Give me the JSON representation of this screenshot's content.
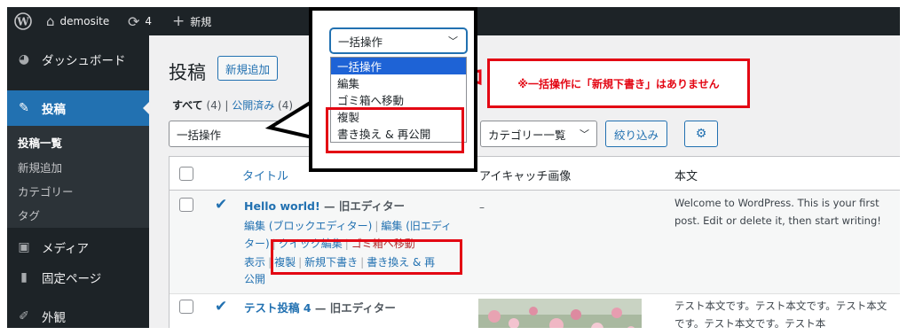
{
  "admin_bar": {
    "wp_logo_icon": "wordpress-icon",
    "site_name": "demosite",
    "updates_count": "4",
    "new_label": "新規"
  },
  "sidebar": {
    "items": [
      {
        "label": "ダッシュボード",
        "icon": "dashboard-icon"
      },
      {
        "label": "投稿",
        "icon": "pin-icon"
      },
      {
        "label": "メディア",
        "icon": "media-icon"
      },
      {
        "label": "固定ページ",
        "icon": "page-icon"
      },
      {
        "label": "外観",
        "icon": "brush-icon"
      }
    ],
    "submenu": [
      "投稿一覧",
      "新規追加",
      "カテゴリー",
      "タグ"
    ]
  },
  "main": {
    "title": "投稿",
    "add_new_label": "新規追加",
    "filter_all": "すべて",
    "filter_all_count": "(4)",
    "filter_published": "公開済み",
    "filter_published_count": "(4)",
    "bulk_action_value": "一括操作",
    "category_select": "カテゴリー一覧",
    "filter_button": "絞り込み",
    "columns": {
      "title": "タイトル",
      "eyecatch": "アイキャッチ画像",
      "content": "本文"
    },
    "rows": [
      {
        "title": "Hello world!",
        "state": " — 旧エディター",
        "eyecatch": "–",
        "actions": {
          "line1_a": "編集 (ブロックエディター)",
          "line1_b": "編集 (旧エディ",
          "line2_a": "ター)",
          "line2_b": "クイック編集",
          "line2_c": "ゴミ箱へ移動",
          "view": "表示",
          "duplicate": "複製",
          "new_draft": "新規下書き",
          "rewrite_a": "書き換え & 再",
          "rewrite_b": "公開"
        },
        "excerpt": "Welcome to WordPress. This is your first post. Edit or delete it, then start writing!"
      },
      {
        "title": "テスト投稿 4",
        "state": " — 旧エディター",
        "excerpt": "テスト本文です。テスト本文です。テスト本文です。テスト本文です。テスト本"
      }
    ]
  },
  "callout": {
    "dropdown_value": "一括操作",
    "options": [
      "一括操作",
      "編集",
      "ゴミ箱へ移動",
      "複製",
      "書き換え & 再公開"
    ],
    "selected_index": 0,
    "highlighted_options": [
      "複製",
      "書き換え & 再公開"
    ]
  },
  "note": "※一括操作に「新規下書き」はありません",
  "colors": {
    "admin_dark": "#1d2327",
    "wp_blue": "#2271b1",
    "highlight_red": "#e30613",
    "select_blue": "#1e63d6"
  }
}
